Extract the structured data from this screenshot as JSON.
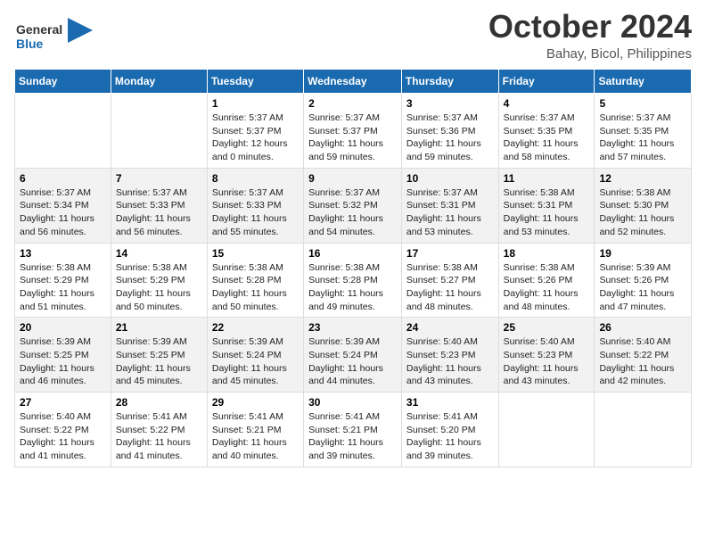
{
  "header": {
    "logo_line1": "General",
    "logo_line2": "Blue",
    "month": "October 2024",
    "location": "Bahay, Bicol, Philippines"
  },
  "days_of_week": [
    "Sunday",
    "Monday",
    "Tuesday",
    "Wednesday",
    "Thursday",
    "Friday",
    "Saturday"
  ],
  "weeks": [
    [
      {
        "date": "",
        "info": ""
      },
      {
        "date": "",
        "info": ""
      },
      {
        "date": "1",
        "info": "Sunrise: 5:37 AM\nSunset: 5:37 PM\nDaylight: 12 hours and 0 minutes."
      },
      {
        "date": "2",
        "info": "Sunrise: 5:37 AM\nSunset: 5:37 PM\nDaylight: 11 hours and 59 minutes."
      },
      {
        "date": "3",
        "info": "Sunrise: 5:37 AM\nSunset: 5:36 PM\nDaylight: 11 hours and 59 minutes."
      },
      {
        "date": "4",
        "info": "Sunrise: 5:37 AM\nSunset: 5:35 PM\nDaylight: 11 hours and 58 minutes."
      },
      {
        "date": "5",
        "info": "Sunrise: 5:37 AM\nSunset: 5:35 PM\nDaylight: 11 hours and 57 minutes."
      }
    ],
    [
      {
        "date": "6",
        "info": "Sunrise: 5:37 AM\nSunset: 5:34 PM\nDaylight: 11 hours and 56 minutes."
      },
      {
        "date": "7",
        "info": "Sunrise: 5:37 AM\nSunset: 5:33 PM\nDaylight: 11 hours and 56 minutes."
      },
      {
        "date": "8",
        "info": "Sunrise: 5:37 AM\nSunset: 5:33 PM\nDaylight: 11 hours and 55 minutes."
      },
      {
        "date": "9",
        "info": "Sunrise: 5:37 AM\nSunset: 5:32 PM\nDaylight: 11 hours and 54 minutes."
      },
      {
        "date": "10",
        "info": "Sunrise: 5:37 AM\nSunset: 5:31 PM\nDaylight: 11 hours and 53 minutes."
      },
      {
        "date": "11",
        "info": "Sunrise: 5:38 AM\nSunset: 5:31 PM\nDaylight: 11 hours and 53 minutes."
      },
      {
        "date": "12",
        "info": "Sunrise: 5:38 AM\nSunset: 5:30 PM\nDaylight: 11 hours and 52 minutes."
      }
    ],
    [
      {
        "date": "13",
        "info": "Sunrise: 5:38 AM\nSunset: 5:29 PM\nDaylight: 11 hours and 51 minutes."
      },
      {
        "date": "14",
        "info": "Sunrise: 5:38 AM\nSunset: 5:29 PM\nDaylight: 11 hours and 50 minutes."
      },
      {
        "date": "15",
        "info": "Sunrise: 5:38 AM\nSunset: 5:28 PM\nDaylight: 11 hours and 50 minutes."
      },
      {
        "date": "16",
        "info": "Sunrise: 5:38 AM\nSunset: 5:28 PM\nDaylight: 11 hours and 49 minutes."
      },
      {
        "date": "17",
        "info": "Sunrise: 5:38 AM\nSunset: 5:27 PM\nDaylight: 11 hours and 48 minutes."
      },
      {
        "date": "18",
        "info": "Sunrise: 5:38 AM\nSunset: 5:26 PM\nDaylight: 11 hours and 48 minutes."
      },
      {
        "date": "19",
        "info": "Sunrise: 5:39 AM\nSunset: 5:26 PM\nDaylight: 11 hours and 47 minutes."
      }
    ],
    [
      {
        "date": "20",
        "info": "Sunrise: 5:39 AM\nSunset: 5:25 PM\nDaylight: 11 hours and 46 minutes."
      },
      {
        "date": "21",
        "info": "Sunrise: 5:39 AM\nSunset: 5:25 PM\nDaylight: 11 hours and 45 minutes."
      },
      {
        "date": "22",
        "info": "Sunrise: 5:39 AM\nSunset: 5:24 PM\nDaylight: 11 hours and 45 minutes."
      },
      {
        "date": "23",
        "info": "Sunrise: 5:39 AM\nSunset: 5:24 PM\nDaylight: 11 hours and 44 minutes."
      },
      {
        "date": "24",
        "info": "Sunrise: 5:40 AM\nSunset: 5:23 PM\nDaylight: 11 hours and 43 minutes."
      },
      {
        "date": "25",
        "info": "Sunrise: 5:40 AM\nSunset: 5:23 PM\nDaylight: 11 hours and 43 minutes."
      },
      {
        "date": "26",
        "info": "Sunrise: 5:40 AM\nSunset: 5:22 PM\nDaylight: 11 hours and 42 minutes."
      }
    ],
    [
      {
        "date": "27",
        "info": "Sunrise: 5:40 AM\nSunset: 5:22 PM\nDaylight: 11 hours and 41 minutes."
      },
      {
        "date": "28",
        "info": "Sunrise: 5:41 AM\nSunset: 5:22 PM\nDaylight: 11 hours and 41 minutes."
      },
      {
        "date": "29",
        "info": "Sunrise: 5:41 AM\nSunset: 5:21 PM\nDaylight: 11 hours and 40 minutes."
      },
      {
        "date": "30",
        "info": "Sunrise: 5:41 AM\nSunset: 5:21 PM\nDaylight: 11 hours and 39 minutes."
      },
      {
        "date": "31",
        "info": "Sunrise: 5:41 AM\nSunset: 5:20 PM\nDaylight: 11 hours and 39 minutes."
      },
      {
        "date": "",
        "info": ""
      },
      {
        "date": "",
        "info": ""
      }
    ]
  ]
}
